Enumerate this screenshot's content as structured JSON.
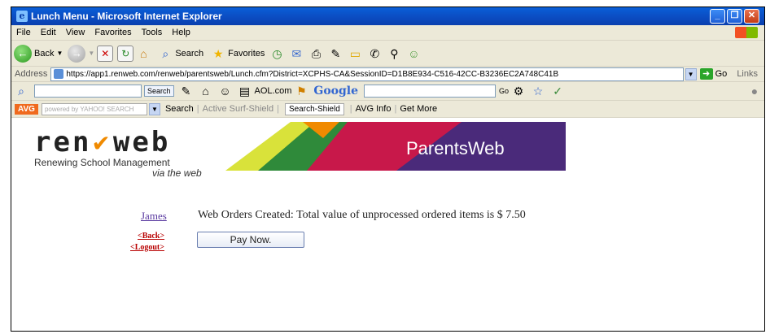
{
  "window": {
    "title": "Lunch Menu - Microsoft Internet Explorer"
  },
  "menu": [
    "File",
    "Edit",
    "View",
    "Favorites",
    "Tools",
    "Help"
  ],
  "toolbar": {
    "back_label": "Back",
    "search_label": "Search",
    "favorites_label": "Favorites"
  },
  "address": {
    "label": "Address",
    "url": "https://app1.renweb.com/renweb/parentsweb/Lunch.cfm?District=XCPHS-CA&SessionID=D1B8E934-C516-42CC-B3236EC2A748C41B",
    "go_label": "Go",
    "links_label": "Links"
  },
  "toolbar3": {
    "search_btn": "Search",
    "aol": "AOL.com",
    "google": "Google",
    "go_label": "Go"
  },
  "avg": {
    "brand": "AVG",
    "yahoo_placeholder": "powered by YAHOO! SEARCH",
    "search_label": "Search",
    "active_surf": "Active Surf-Shield",
    "search_shield": "Search-Shield",
    "avg_info": "AVG Info",
    "get_more": "Get More"
  },
  "page": {
    "logo_word_left": "ren",
    "logo_word_right": "web",
    "logo_tagline": "Renewing School Management",
    "logo_tagline2": "via the web",
    "banner_text": "ParentsWeb",
    "student_name": "James",
    "message": "Web Orders Created: Total value of unprocessed ordered items is $ 7.50",
    "back_link": "<Back>",
    "logout_link": "<Logout>",
    "pay_button": "Pay Now."
  }
}
